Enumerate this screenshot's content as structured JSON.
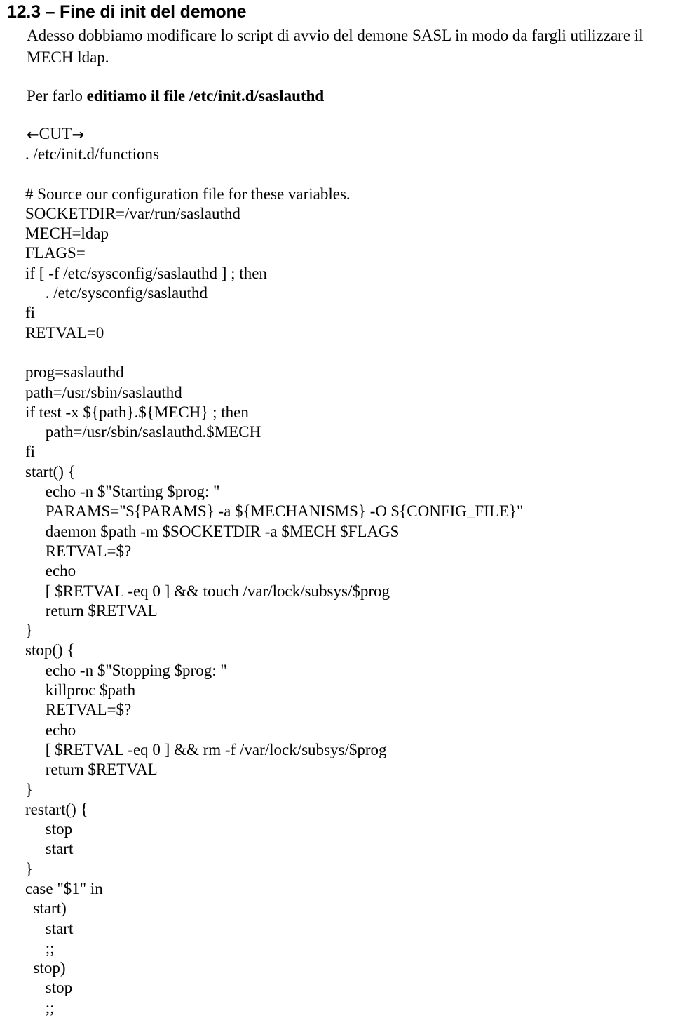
{
  "document": {
    "heading": "12.3 – Fine di init del demone",
    "paragraphs": [
      {
        "id": "intro",
        "runs": [
          {
            "text": "Adesso dobbiamo modificare lo script di avvio del demone SASL in modo da fargli utilizzare il MECH ldap.",
            "bold": false
          }
        ]
      },
      {
        "id": "instruction",
        "runs": [
          {
            "text": "Per farlo ",
            "bold": false
          },
          {
            "text": "editiamo il file /etc/init.d/saslauthd",
            "bold": true
          }
        ]
      }
    ],
    "intro_text": "Adesso dobbiamo modificare lo script di avvio del demone SASL in modo da fargli utilizzare il MECH ldap.",
    "instruction_prefix": "Per farlo ",
    "instruction_bold": "editiamo il file /etc/init.d/saslauthd",
    "cut_marker": {
      "left_arrow": "←",
      "label": "CUT",
      "right_arrow": "→"
    },
    "code_block": {
      "language": "shell",
      "lines": [
        ". /etc/init.d/functions",
        "",
        "# Source our configuration file for these variables.",
        "SOCKETDIR=/var/run/saslauthd",
        "MECH=ldap",
        "FLAGS=",
        "if [ -f /etc/sysconfig/saslauthd ] ; then",
        "     . /etc/sysconfig/saslauthd",
        "fi",
        "RETVAL=0",
        "",
        "prog=saslauthd",
        "path=/usr/sbin/saslauthd",
        "if test -x ${path}.${MECH} ; then",
        "     path=/usr/sbin/saslauthd.$MECH",
        "fi",
        "start() {",
        "     echo -n $\"Starting $prog: \"",
        "     PARAMS=\"${PARAMS} -a ${MECHANISMS} -O ${CONFIG_FILE}\"",
        "     daemon $path -m $SOCKETDIR -a $MECH $FLAGS",
        "     RETVAL=$?",
        "     echo",
        "     [ $RETVAL -eq 0 ] && touch /var/lock/subsys/$prog",
        "     return $RETVAL",
        "}",
        "stop() {",
        "     echo -n $\"Stopping $prog: \"",
        "     killproc $path",
        "     RETVAL=$?",
        "     echo",
        "     [ $RETVAL -eq 0 ] && rm -f /var/lock/subsys/$prog",
        "     return $RETVAL",
        "}",
        "restart() {",
        "     stop",
        "     start",
        "}",
        "case \"$1\" in",
        "  start)",
        "     start",
        "     ;;",
        "  stop)",
        "     stop",
        "     ;;"
      ]
    }
  }
}
